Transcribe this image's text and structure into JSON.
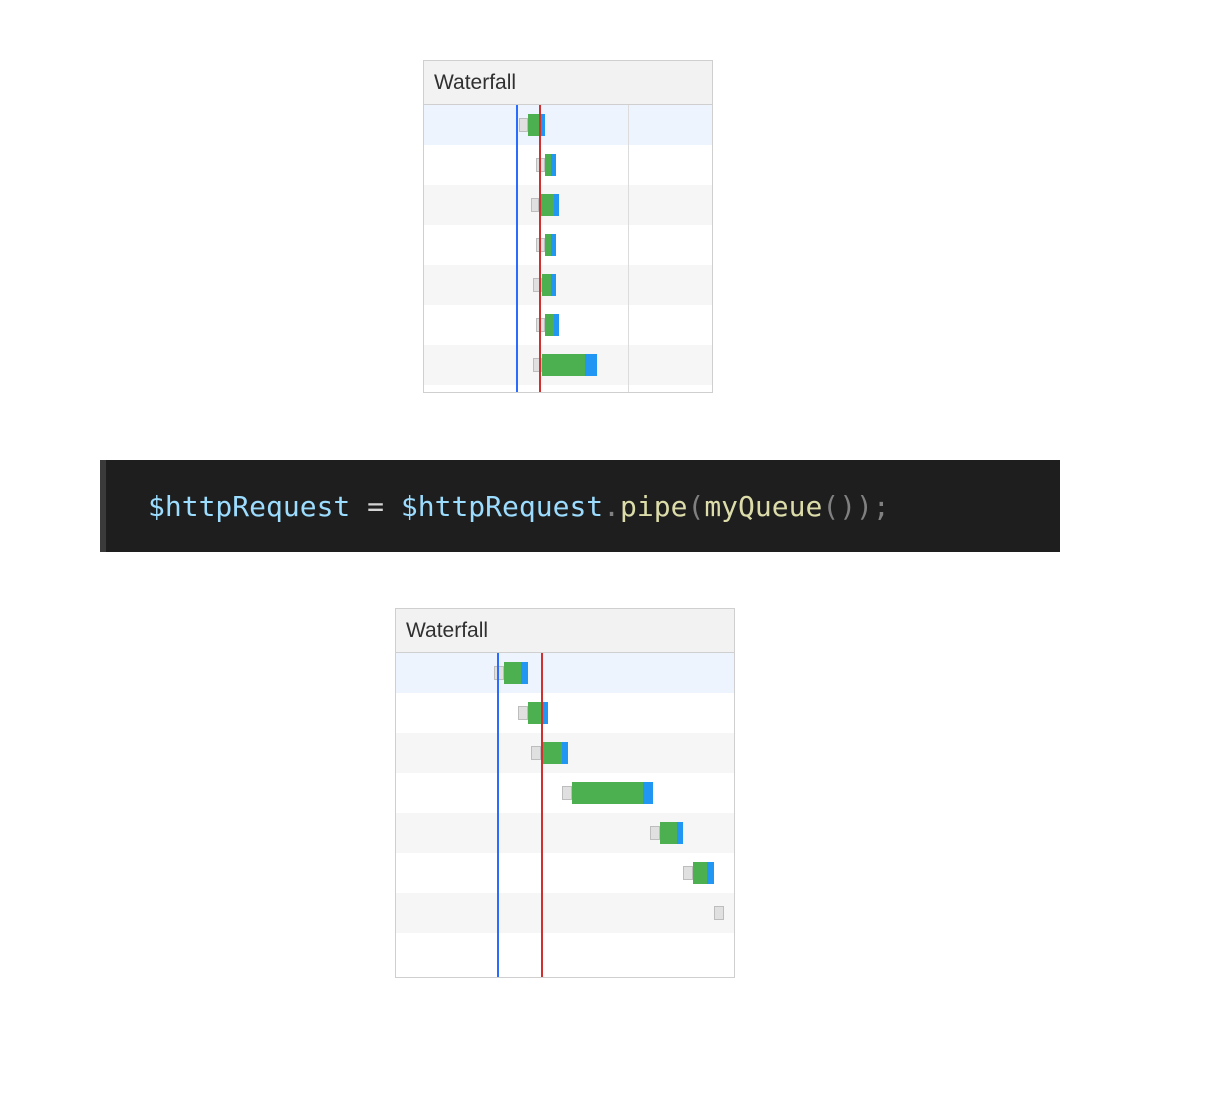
{
  "waterfall_top": {
    "title": "Waterfall",
    "blue_line_pct": 32,
    "red_line_pct": 40,
    "grid_pct": 71,
    "rows": [
      {
        "striped": true,
        "kind": "highlight",
        "bar": {
          "left_pct": 33,
          "queue_w": 3,
          "green_w": 4,
          "blue_w": 2
        }
      },
      {
        "striped": false,
        "bar": {
          "left_pct": 39,
          "queue_w": 3,
          "green_w": 2,
          "blue_w": 2
        }
      },
      {
        "striped": true,
        "bar": {
          "left_pct": 37,
          "queue_w": 3,
          "green_w": 5,
          "blue_w": 2
        }
      },
      {
        "striped": false,
        "bar": {
          "left_pct": 39,
          "queue_w": 3,
          "green_w": 2,
          "blue_w": 2
        }
      },
      {
        "striped": true,
        "bar": {
          "left_pct": 38,
          "queue_w": 3,
          "green_w": 3,
          "blue_w": 2
        }
      },
      {
        "striped": false,
        "bar": {
          "left_pct": 39,
          "queue_w": 3,
          "green_w": 3,
          "blue_w": 2
        }
      },
      {
        "striped": true,
        "bar": {
          "left_pct": 38,
          "queue_w": 3,
          "green_w": 15,
          "blue_w": 4
        }
      }
    ]
  },
  "waterfall_bottom": {
    "title": "Waterfall",
    "blue_line_pct": 30,
    "red_line_pct": 43,
    "rows": [
      {
        "striped": false,
        "kind": "highlight",
        "bar": {
          "left_pct": 29,
          "queue_w": 3,
          "green_w": 5,
          "blue_w": 2
        }
      },
      {
        "striped": false,
        "bar": {
          "left_pct": 36,
          "queue_w": 3,
          "green_w": 4,
          "blue_w": 2
        }
      },
      {
        "striped": true,
        "bar": {
          "left_pct": 40,
          "queue_w": 3,
          "green_w": 6,
          "blue_w": 2
        }
      },
      {
        "striped": false,
        "bar": {
          "left_pct": 49,
          "queue_w": 3,
          "green_w": 21,
          "blue_w": 3
        }
      },
      {
        "striped": true,
        "bar": {
          "left_pct": 75,
          "queue_w": 3,
          "green_w": 5,
          "blue_w": 2
        }
      },
      {
        "striped": false,
        "bar": {
          "left_pct": 85,
          "queue_w": 3,
          "green_w": 4,
          "blue_w": 2
        }
      },
      {
        "striped": true,
        "bar": {
          "left_pct": 94,
          "queue_w": 3,
          "green_w": 0,
          "blue_w": 0
        }
      }
    ]
  },
  "code": {
    "tokens": [
      {
        "cls": "tok-var",
        "text": "$httpRequest"
      },
      {
        "cls": "tok-op",
        "text": " = "
      },
      {
        "cls": "tok-var",
        "text": "$httpRequest"
      },
      {
        "cls": "tok-punct",
        "text": "."
      },
      {
        "cls": "tok-method",
        "text": "pipe"
      },
      {
        "cls": "tok-punct",
        "text": "("
      },
      {
        "cls": "tok-call",
        "text": "myQueue"
      },
      {
        "cls": "tok-punct",
        "text": "());"
      }
    ]
  },
  "colors": {
    "marker_blue": "#2b6cff",
    "marker_red": "#d03030"
  }
}
